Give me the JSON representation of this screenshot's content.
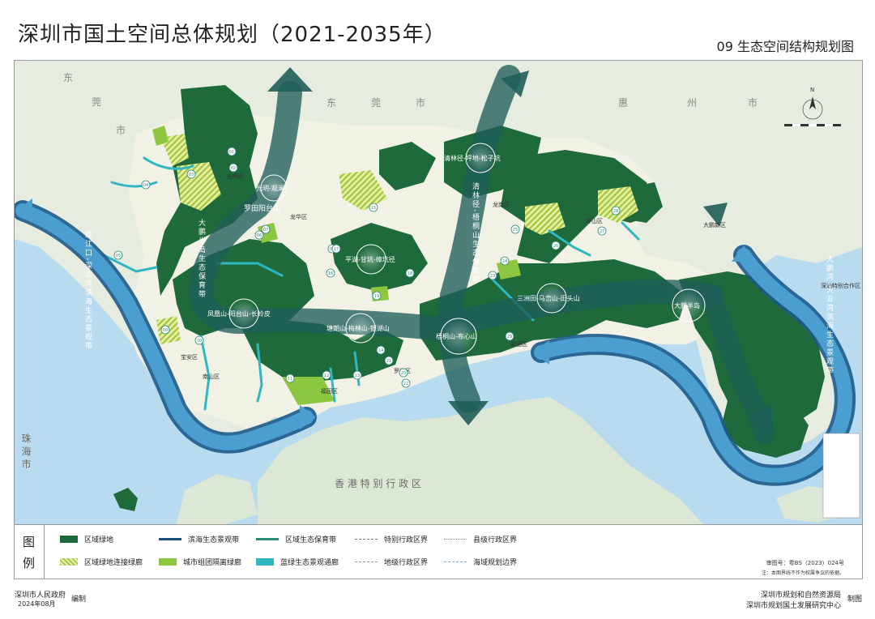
{
  "header": {
    "title": "深圳市国土空间总体规划（2021-2035年）",
    "subtitle": "09  生态空间结构规划图"
  },
  "map": {
    "colors": {
      "sea": "#b9dbef",
      "land": "#e6ecdf",
      "regional_green": "#1e6a3b",
      "coast_band": "#2f7fb3",
      "protection_band": "#1f5e58",
      "blue_green": "#2fb8c0",
      "city_green": "#8dc63f"
    },
    "city_labels": [
      "东",
      "莞",
      "市",
      "东",
      "莞",
      "市",
      "惠",
      "州",
      "市"
    ],
    "sar_label": "香 港 特 别 行 政 区",
    "zhuhai_label": "珠 海 市",
    "district_labels": [
      "光明区",
      "龙华区",
      "宝安区",
      "南山区",
      "福田区",
      "罗湖区",
      "盐田区",
      "坪山区",
      "龙岗区",
      "大鹏新区",
      "深汕特别合作区"
    ],
    "nodes": [
      "光明-观澜",
      "平湖-甘坑-樟坑径",
      "清林径-坪地-松子坑",
      "凤凰山-阳台山-长岭皮",
      "塘朗山-梅林山-银湖山",
      "梧桐山-布心山",
      "三洲田-马峦山-田头山",
      "大鹏半岛"
    ],
    "bands": [
      "珠江口-深圳湾滨海生态景观带",
      "大鹏湾-大亚湾滨海生态景观带",
      "大鹏半岛-阳台山生态保育带",
      "清林径-梧桐山生态保育带"
    ],
    "band_text_left": [
      "大",
      "鹏",
      "半",
      "岛",
      "生",
      "态",
      "保",
      "育",
      "带"
    ],
    "band_text_top": [
      "罗",
      "田",
      "阳",
      "台",
      "山"
    ],
    "band_text_mid": [
      "清",
      "林",
      "径",
      "-",
      "梧",
      "桐",
      "山",
      "生",
      "态",
      "保",
      "育",
      "带"
    ],
    "band_text_west": [
      "珠",
      "江",
      "口",
      "-",
      "深",
      "圳",
      "湾",
      "滨",
      "海",
      "生",
      "态",
      "景",
      "观",
      "带"
    ],
    "band_text_east": [
      "大",
      "鹏",
      "湾",
      "-",
      "大",
      "亚",
      "湾",
      "滨",
      "海",
      "生",
      "态",
      "景",
      "观",
      "带"
    ],
    "corridor_numbers": [
      "01",
      "02",
      "03",
      "04",
      "05",
      "06",
      "07",
      "08",
      "09",
      "10",
      "11",
      "12",
      "13",
      "14",
      "15",
      "16",
      "17",
      "18",
      "19",
      "20",
      "21",
      "22",
      "23",
      "24",
      "25",
      "26",
      "27",
      "28",
      "29"
    ],
    "north_label": "N"
  },
  "legend": {
    "head": [
      "图",
      "例"
    ],
    "items": [
      {
        "label": "区域绿地",
        "kind": "green"
      },
      {
        "label": "区域绿地连接绿廊",
        "kind": "hatch"
      },
      {
        "label": "滨海生态景观带",
        "kind": "blue-arrow"
      },
      {
        "label": "城市组团隔离绿廊",
        "kind": "light"
      },
      {
        "label": "区域生态保育带",
        "kind": "teal-arrow"
      },
      {
        "label": "蓝绿生态景观通廊",
        "kind": "teal"
      },
      {
        "label": "特别行政区界",
        "kind": "dash"
      },
      {
        "label": "地级行政区界",
        "kind": "dashdot"
      },
      {
        "label": "县级行政区界",
        "kind": "dot"
      },
      {
        "label": "海域规划边界",
        "kind": "sea"
      }
    ]
  },
  "review": {
    "code": "审图号：粤BS（2023）024号",
    "note": "注：本图界线不作为权属争议的依据。"
  },
  "footer": {
    "left_org": "深圳市人民政府",
    "left_date": "2024年08月",
    "left_action": "编制",
    "right_org1": "深圳市规划和自然资源局",
    "right_org2": "深圳市规划国土发展研究中心",
    "right_action": "制图"
  }
}
